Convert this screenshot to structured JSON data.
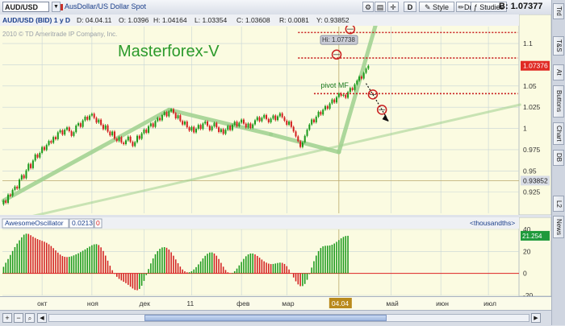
{
  "toolbar": {
    "symbol": "AUD/USD",
    "description": "AusDollar/US Dollar Spot",
    "d_label": "D",
    "style_label": "Style",
    "drawings_label": "Drawings",
    "studies_label": "Studies",
    "bid_value": "B: 1.07377"
  },
  "sidebar": {
    "tabs": [
      "Trd",
      "T&S",
      "At",
      "Buttons",
      "Chart",
      "DB",
      "L2",
      "News"
    ]
  },
  "colors": {
    "plot_bg": "#fbfbe1",
    "grid": "#c7d4d6",
    "up_candle": "#1c9a1c",
    "down_candle": "#d32020",
    "wave_line": "#9fd18f",
    "level_line": "#c81f1f",
    "price_badge": "#e02a24",
    "cursor_badge": "#d9dde6",
    "osc_badge": "#1f9a3c",
    "date_badge": "#b98a1c"
  },
  "chart_data": [
    {
      "type": "candlestick",
      "header": {
        "title": "AUD/USD (BID) 1 y D",
        "d_field": "D: 04.04.11",
        "o_field": "O: 1.0396",
        "h_field": "H: 1.04164",
        "l_field": "L: 1.03354",
        "c_field": "C: 1.03608",
        "r_field": "R: 0.0081",
        "y_field": "Y: 0.93852"
      },
      "copyright": "2010 © TD Ameritrade IP Company, Inc.",
      "watermark": "Masterforex-V",
      "ylim": [
        0.9,
        1.12
      ],
      "y_ticks": [
        0.925,
        0.95,
        0.975,
        1,
        1.025,
        1.05,
        1.075,
        1.1
      ],
      "y_tick_labels": [
        "0.925",
        "0.95",
        "0.975",
        "1",
        "1.025",
        "1.05",
        "1.075",
        "1.1"
      ],
      "x_labels": [
        {
          "label": "окт",
          "bar": 17
        },
        {
          "label": "ноя",
          "bar": 39
        },
        {
          "label": "дек",
          "bar": 62
        },
        {
          "label": "11",
          "bar": 83
        },
        {
          "label": "фев",
          "bar": 105
        },
        {
          "label": "мар",
          "bar": 125
        },
        {
          "label": "май",
          "bar": 171
        },
        {
          "label": "июн",
          "bar": 193
        },
        {
          "label": "июл",
          "bar": 214
        }
      ],
      "price_badge": "1.07376",
      "cursor_price_badge": "0.93852",
      "cursor_date_badge": "04.04",
      "cursor_price": 0.93852,
      "cursor_bar": 148,
      "bars_total": 228,
      "candles": [
        {
          "o": 0.9105,
          "c": 0.9149
        },
        {
          "o": 0.9149,
          "c": 0.9123
        },
        {
          "o": 0.9123,
          "c": 0.9221
        },
        {
          "o": 0.9221,
          "c": 0.9206
        },
        {
          "o": 0.9206,
          "c": 0.9276
        },
        {
          "o": 0.9276,
          "c": 0.9315
        },
        {
          "o": 0.9315,
          "c": 0.9291
        },
        {
          "o": 0.9291,
          "c": 0.9398
        },
        {
          "o": 0.9398,
          "c": 0.9449
        },
        {
          "o": 0.9449,
          "c": 0.9413
        },
        {
          "o": 0.9413,
          "c": 0.9506
        },
        {
          "o": 0.9506,
          "c": 0.9582
        },
        {
          "o": 0.9582,
          "c": 0.9532
        },
        {
          "o": 0.9532,
          "c": 0.9622
        },
        {
          "o": 0.9622,
          "c": 0.9693
        },
        {
          "o": 0.9693,
          "c": 0.9657
        },
        {
          "o": 0.9657,
          "c": 0.9711
        },
        {
          "o": 0.9711,
          "c": 0.9781
        },
        {
          "o": 0.9781,
          "c": 0.9746
        },
        {
          "o": 0.9746,
          "c": 0.9805
        },
        {
          "o": 0.9805,
          "c": 0.9852
        },
        {
          "o": 0.9852,
          "c": 0.9831
        },
        {
          "o": 0.9831,
          "c": 0.9899
        },
        {
          "o": 0.9899,
          "c": 0.9873
        },
        {
          "o": 0.9873,
          "c": 0.9954
        },
        {
          "o": 0.9954,
          "c": 0.9978
        },
        {
          "o": 0.9978,
          "c": 0.9927
        },
        {
          "o": 0.9927,
          "c": 0.9985
        },
        {
          "o": 0.9985,
          "c": 1.0012
        },
        {
          "o": 1.0012,
          "c": 0.9968
        },
        {
          "o": 0.9968,
          "c": 0.9912
        },
        {
          "o": 0.9912,
          "c": 0.9956
        },
        {
          "o": 0.9956,
          "c": 1.0034
        },
        {
          "o": 1.0034,
          "c": 1.0061
        },
        {
          "o": 1.0061,
          "c": 1.0018
        },
        {
          "o": 1.0018,
          "c": 1.0095
        },
        {
          "o": 1.0095,
          "c": 1.0138
        },
        {
          "o": 1.0138,
          "c": 1.0102
        },
        {
          "o": 1.0102,
          "c": 1.0151
        },
        {
          "o": 1.0151,
          "c": 1.0173
        },
        {
          "o": 1.0173,
          "c": 1.0124
        },
        {
          "o": 1.0124,
          "c": 1.0069
        },
        {
          "o": 1.0069,
          "c": 1.0103
        },
        {
          "o": 1.0103,
          "c": 1.0042
        },
        {
          "o": 1.0042,
          "c": 0.9991
        },
        {
          "o": 0.9991,
          "c": 1.0036
        },
        {
          "o": 1.0036,
          "c": 0.9962
        },
        {
          "o": 0.9962,
          "c": 0.9918
        },
        {
          "o": 0.9918,
          "c": 0.9963
        },
        {
          "o": 0.9963,
          "c": 0.9879
        },
        {
          "o": 0.9879,
          "c": 0.9851
        },
        {
          "o": 0.9851,
          "c": 0.9897
        },
        {
          "o": 0.9897,
          "c": 0.9833
        },
        {
          "o": 0.9833,
          "c": 0.9815
        },
        {
          "o": 0.9815,
          "c": 0.9859
        },
        {
          "o": 0.9859,
          "c": 0.9903
        },
        {
          "o": 0.9903,
          "c": 0.9842
        },
        {
          "o": 0.9842,
          "c": 0.9792
        },
        {
          "o": 0.9792,
          "c": 0.9838
        },
        {
          "o": 0.9838,
          "c": 0.9913
        },
        {
          "o": 0.9913,
          "c": 0.9878
        },
        {
          "o": 0.9878,
          "c": 0.9942
        },
        {
          "o": 0.9942,
          "c": 0.9987
        },
        {
          "o": 0.9987,
          "c": 0.9949
        },
        {
          "o": 0.9949,
          "c": 1.0026
        },
        {
          "o": 1.0026,
          "c": 1.0059
        },
        {
          "o": 1.0059,
          "c": 1.0018
        },
        {
          "o": 1.0018,
          "c": 1.0087
        },
        {
          "o": 1.0087,
          "c": 1.0124
        },
        {
          "o": 1.0124,
          "c": 1.0096
        },
        {
          "o": 1.0096,
          "c": 1.0157
        },
        {
          "o": 1.0157,
          "c": 1.0192
        },
        {
          "o": 1.0192,
          "c": 1.0143
        },
        {
          "o": 1.0143,
          "c": 1.0201
        },
        {
          "o": 1.0201,
          "c": 1.0226
        },
        {
          "o": 1.0226,
          "c": 1.0181
        },
        {
          "o": 1.0181,
          "c": 1.0119
        },
        {
          "o": 1.0119,
          "c": 1.0155
        },
        {
          "o": 1.0155,
          "c": 1.0087
        },
        {
          "o": 1.0087,
          "c": 1.0046
        },
        {
          "o": 1.0046,
          "c": 1.0081
        },
        {
          "o": 1.0081,
          "c": 1.0013
        },
        {
          "o": 1.0013,
          "c": 0.9974
        },
        {
          "o": 0.9974,
          "c": 1.0018
        },
        {
          "o": 1.0018,
          "c": 0.9953
        },
        {
          "o": 0.9953,
          "c": 0.9996
        },
        {
          "o": 0.9996,
          "c": 1.0041
        },
        {
          "o": 1.0041,
          "c": 0.9994
        },
        {
          "o": 0.9994,
          "c": 1.0058
        },
        {
          "o": 1.0058,
          "c": 1.0082
        },
        {
          "o": 1.0082,
          "c": 1.0031
        },
        {
          "o": 1.0031,
          "c": 0.9978
        },
        {
          "o": 0.9978,
          "c": 1.0024
        },
        {
          "o": 1.0024,
          "c": 1.0065
        },
        {
          "o": 1.0065,
          "c": 1.0012
        },
        {
          "o": 1.0012,
          "c": 0.9958
        },
        {
          "o": 0.9958,
          "c": 0.9991
        },
        {
          "o": 0.9991,
          "c": 0.9936
        },
        {
          "o": 0.9936,
          "c": 0.9984
        },
        {
          "o": 0.9984,
          "c": 1.0031
        },
        {
          "o": 1.0031,
          "c": 0.9981
        },
        {
          "o": 0.9981,
          "c": 1.0042
        },
        {
          "o": 1.0042,
          "c": 1.0079
        },
        {
          "o": 1.0079,
          "c": 1.0026
        },
        {
          "o": 1.0026,
          "c": 1.0068
        },
        {
          "o": 1.0068,
          "c": 1.0104
        },
        {
          "o": 1.0104,
          "c": 1.0056
        },
        {
          "o": 1.0056,
          "c": 1.0012
        },
        {
          "o": 1.0012,
          "c": 1.0058
        },
        {
          "o": 1.0058,
          "c": 1.0006
        },
        {
          "o": 1.0006,
          "c": 1.0048
        },
        {
          "o": 1.0048,
          "c": 1.0096
        },
        {
          "o": 1.0096,
          "c": 1.0132
        },
        {
          "o": 1.0132,
          "c": 1.0085
        },
        {
          "o": 1.0085,
          "c": 1.0124
        },
        {
          "o": 1.0124,
          "c": 1.0158
        },
        {
          "o": 1.0158,
          "c": 1.0111
        },
        {
          "o": 1.0111,
          "c": 1.0072
        },
        {
          "o": 1.0072,
          "c": 1.0115
        },
        {
          "o": 1.0115,
          "c": 1.0152
        },
        {
          "o": 1.0152,
          "c": 1.0098
        },
        {
          "o": 1.0098,
          "c": 1.0143
        },
        {
          "o": 1.0143,
          "c": 1.0178
        },
        {
          "o": 1.0178,
          "c": 1.0132
        },
        {
          "o": 1.0132,
          "c": 1.0091
        },
        {
          "o": 1.0091,
          "c": 1.0043
        },
        {
          "o": 1.0043,
          "c": 1.0082
        },
        {
          "o": 1.0082,
          "c": 1.0018
        },
        {
          "o": 1.0018,
          "c": 0.9964
        },
        {
          "o": 0.9964,
          "c": 0.9906
        },
        {
          "o": 0.9906,
          "c": 0.9849
        },
        {
          "o": 0.9849,
          "c": 0.9781
        },
        {
          "o": 0.9781,
          "c": 0.9836
        },
        {
          "o": 0.9836,
          "c": 0.9912
        },
        {
          "o": 0.9912,
          "c": 0.9985
        },
        {
          "o": 0.9985,
          "c": 1.0046
        },
        {
          "o": 1.0046,
          "c": 1.0105
        },
        {
          "o": 1.0105,
          "c": 1.0072
        },
        {
          "o": 1.0072,
          "c": 1.0138
        },
        {
          "o": 1.0138,
          "c": 1.0196
        },
        {
          "o": 1.0196,
          "c": 1.0163
        },
        {
          "o": 1.0163,
          "c": 1.0221
        },
        {
          "o": 1.0221,
          "c": 1.0263
        },
        {
          "o": 1.0263,
          "c": 1.0232
        },
        {
          "o": 1.0232,
          "c": 1.0294
        },
        {
          "o": 1.0294,
          "c": 1.0341
        },
        {
          "o": 1.0341,
          "c": 1.0306
        },
        {
          "o": 1.0306,
          "c": 1.0368
        },
        {
          "o": 1.0368,
          "c": 1.0412
        },
        {
          "o": 1.0412,
          "c": 1.0385
        },
        {
          "o": 1.0385,
          "c": 1.0396
        },
        {
          "o": 1.0396,
          "c": 1.0361
        },
        {
          "o": 1.0361,
          "c": 1.0428
        },
        {
          "o": 1.0428,
          "c": 1.0476
        },
        {
          "o": 1.0476,
          "c": 1.0452
        },
        {
          "o": 1.0452,
          "c": 1.0519
        },
        {
          "o": 1.0519,
          "c": 1.0563
        },
        {
          "o": 1.0563,
          "c": 1.0611
        },
        {
          "o": 1.0611,
          "c": 1.0587
        },
        {
          "o": 1.0587,
          "c": 1.0655
        },
        {
          "o": 1.0655,
          "c": 1.0704
        },
        {
          "o": 1.0704,
          "c": 1.0738
        }
      ],
      "annotations": {
        "hi_label": "Hi: 1.07738",
        "pivot_label": "pivot MF",
        "wave_up_1": [
          {
            "bar": 0,
            "price": 0.915
          },
          {
            "bar": 73,
            "price": 1.022
          }
        ],
        "wave_down": [
          {
            "bar": 73,
            "price": 1.022
          },
          {
            "bar": 118,
            "price": 0.993
          }
        ],
        "wave_up_2": [
          {
            "bar": 118,
            "price": 0.993
          },
          {
            "bar": 148,
            "price": 0.972
          }
        ],
        "wave_up_3": [
          {
            "bar": 148,
            "price": 0.972
          },
          {
            "bar": 165,
            "price": 1.129
          }
        ],
        "support_line": [
          {
            "bar": 10,
            "price": 0.895
          },
          {
            "bar": 228,
            "price": 1.028
          }
        ],
        "levels": [
          {
            "price": 1.113,
            "bar_from": 130,
            "bar_to": 227
          },
          {
            "price": 1.083,
            "bar_from": 130,
            "bar_to": 227
          },
          {
            "price": 1.041,
            "bar_from": 137,
            "bar_to": 227
          }
        ],
        "circles": [
          {
            "bar": 153,
            "price": 1.117
          },
          {
            "bar": 147,
            "price": 1.087
          },
          {
            "bar": 163,
            "price": 1.04
          },
          {
            "bar": 167,
            "price": 1.022
          }
        ],
        "projection": [
          {
            "bar": 160,
            "price": 1.053
          },
          {
            "bar": 163,
            "price": 1.04
          },
          {
            "bar": 167,
            "price": 1.022
          },
          {
            "bar": 170,
            "price": 1.008
          }
        ]
      }
    },
    {
      "type": "bar",
      "title": "AwesomeOscillator",
      "current_value": "0.0213",
      "flag_value": "0",
      "units_label": "<thousandths>",
      "ylim": [
        -20,
        40
      ],
      "y_ticks": [
        -20,
        0,
        20,
        40
      ],
      "y_tick_labels": [
        "-20",
        "0",
        "20",
        "40"
      ],
      "value_badge": "21.254",
      "values": [
        6.0,
        9.7,
        13.1,
        16.8,
        20.4,
        23.9,
        27.1,
        30.1,
        32.8,
        35.2,
        36.1,
        35.9,
        34.7,
        33.3,
        32.2,
        31.2,
        30.4,
        29.6,
        28.8,
        27.8,
        26.5,
        24.9,
        23.0,
        20.9,
        18.9,
        17.1,
        15.8,
        15.1,
        14.9,
        15.1,
        15.6,
        16.4,
        17.3,
        18.3,
        19.4,
        20.6,
        21.8,
        23.1,
        24.4,
        25.6,
        26.4,
        26.6,
        25.8,
        23.7,
        20.4,
        16.2,
        11.6,
        7.0,
        2.9,
        -0.5,
        -3.1,
        -5.0,
        -6.4,
        -7.6,
        -8.9,
        -10.4,
        -12.1,
        -13.7,
        -15.0,
        -15.3,
        -14.1,
        -11.2,
        -6.8,
        -1.5,
        4.0,
        9.1,
        13.6,
        17.4,
        20.3,
        22.4,
        23.6,
        23.9,
        23.3,
        21.7,
        19.2,
        16.1,
        12.7,
        9.3,
        6.2,
        3.6,
        1.9,
        1.0,
        1.1,
        2.0,
        3.6,
        5.7,
        8.2,
        10.9,
        13.6,
        16.0,
        17.9,
        19.0,
        19.1,
        18.1,
        16.1,
        13.1,
        9.6,
        6.1,
        3.1,
        1.0,
        0.1,
        0.5,
        2.0,
        4.4,
        7.3,
        10.4,
        13.2,
        15.6,
        17.3,
        18.1,
        18.1,
        17.3,
        15.9,
        14.3,
        12.6,
        11.0,
        9.8,
        8.9,
        8.5,
        8.6,
        9.0,
        9.5,
        9.8,
        9.6,
        8.6,
        6.6,
        3.6,
        0.0,
        -3.7,
        -7.2,
        -10.0,
        -11.6,
        -11.5,
        -9.6,
        -5.8,
        -0.6,
        5.3,
        11.1,
        16.2,
        20.3,
        23.1,
        24.6,
        25.1,
        25.2,
        25.4,
        26.1,
        27.2,
        28.7,
        30.3,
        31.9,
        33.2,
        34.0,
        34.2
      ]
    }
  ]
}
